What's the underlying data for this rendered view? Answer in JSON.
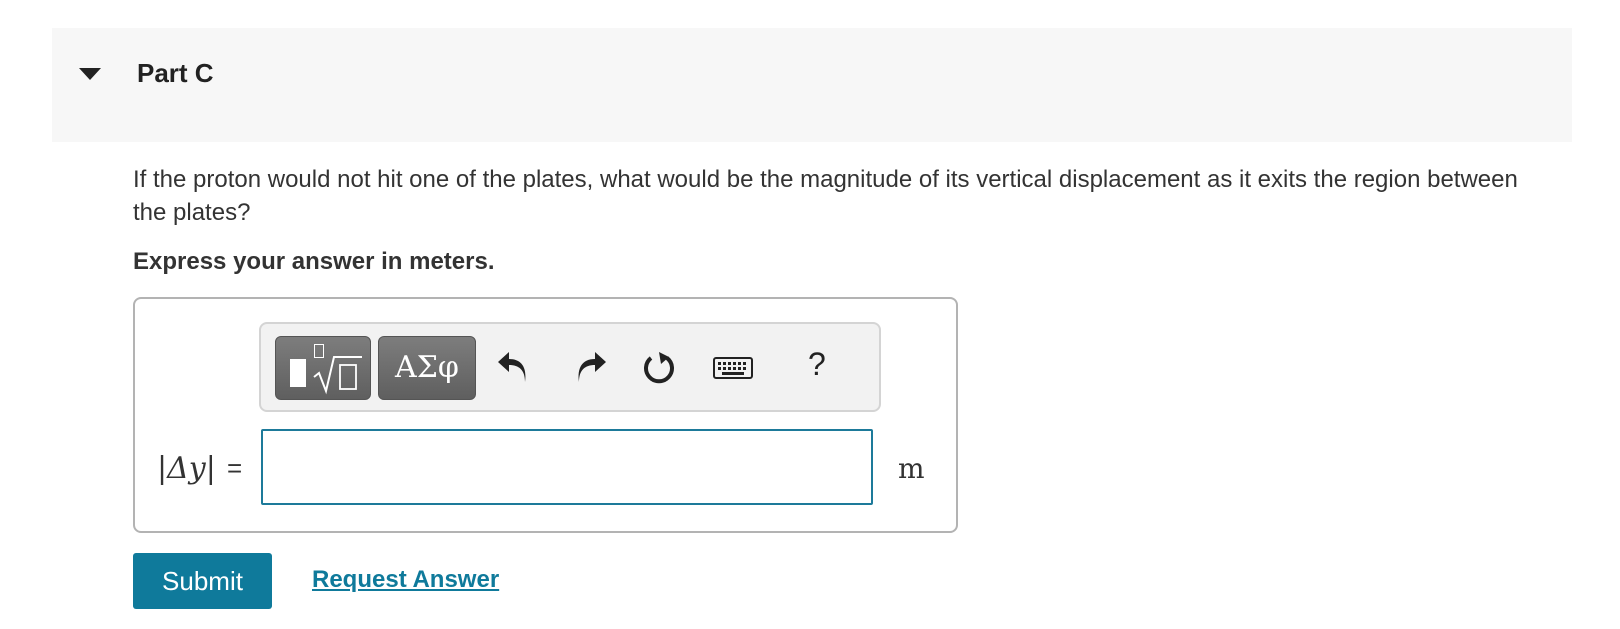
{
  "part": {
    "title": "Part C"
  },
  "question": {
    "text": "If the proton would not hit one of the plates, what would be the magnitude of its vertical displacement as it exits the region between the plates?",
    "instruction": "Express your answer in meters."
  },
  "toolbar": {
    "templates_icon": "templates-icon",
    "greek_label": "ΑΣφ",
    "undo_icon": "undo-icon",
    "redo_icon": "redo-icon",
    "reset_icon": "reset-icon",
    "keyboard_icon": "keyboard-icon",
    "help_label": "?"
  },
  "answer": {
    "variable": "Δy",
    "equals": "=",
    "value": "",
    "unit": "m"
  },
  "actions": {
    "submit_label": "Submit",
    "request_label": "Request Answer"
  },
  "colors": {
    "accent": "#0f7a9b",
    "header_bg": "#f7f7f7",
    "toolbar_button": "#6e6e6e"
  }
}
